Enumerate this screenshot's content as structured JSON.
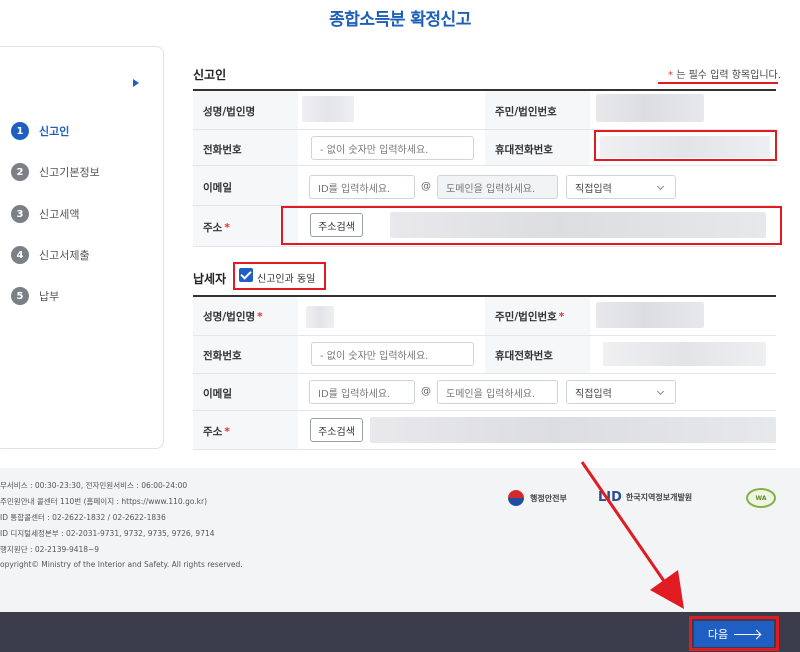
{
  "page": {
    "title": "종합소득분 확정신고"
  },
  "steps": [
    {
      "num": "1",
      "label": "신고인"
    },
    {
      "num": "2",
      "label": "신고기본정보"
    },
    {
      "num": "3",
      "label": "신고세액"
    },
    {
      "num": "4",
      "label": "신고서제출"
    },
    {
      "num": "5",
      "label": "납부"
    }
  ],
  "reporter": {
    "title": "신고인",
    "required_note": "는 필수 입력 항목입니다.",
    "required_mark": "*",
    "labels": {
      "name": "성명/법인명",
      "id": "주민/법인번호",
      "phone": "전화번호",
      "mobile": "휴대전화번호",
      "email": "이메일",
      "address": "주소"
    },
    "phone_placeholder": "- 없이 숫자만 입력하세요.",
    "email_id_placeholder": "ID를 입력하세요.",
    "email_at": "@",
    "email_domain_placeholder": "도메인을 입력하세요.",
    "email_select": "직접입력",
    "address_button": "주소검색"
  },
  "taxpayer": {
    "title": "납세자",
    "same_checkbox": "신고인과 동일",
    "labels": {
      "name": "성명/법인명",
      "id": "주민/법인번호",
      "phone": "전화번호",
      "mobile": "휴대전화번호",
      "email": "이메일",
      "address": "주소"
    },
    "phone_placeholder": "- 없이 숫자만 입력하세요.",
    "email_id_placeholder": "ID를 입력하세요.",
    "email_at": "@",
    "email_domain_placeholder": "도메인을 입력하세요.",
    "email_select": "직접입력",
    "address_button": "주소검색"
  },
  "footer": {
    "lines": [
      "무서비스 : 00:30-23:30, 전자민원서비스 : 06:00-24:00",
      "주민원안내 콜센터 110번 (홈페이지 : https://www.110.go.kr)",
      "ID 통합콜센터 : 02-2622-1832 / 02-2622-1836",
      "ID 디지털세정본부 : 02-2031-9731, 9732, 9735, 9726, 9714",
      "행지원단 : 02-2139-9418~9",
      "opyright© Ministry of the Interior and Safety. All rights reserved."
    ],
    "logo_mois": "행정안전부",
    "logo_lid_mark": "LID",
    "logo_lid": "한국지역정보개발원",
    "logo_badge": "WA"
  },
  "next_button": "다음",
  "colors": {
    "accent": "#1f5fc4",
    "highlight": "#e01b22",
    "bottom_bar": "#3b3d4c"
  }
}
